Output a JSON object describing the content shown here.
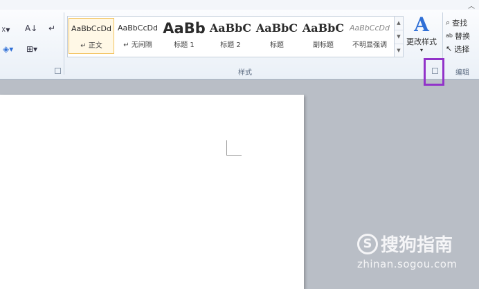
{
  "ribbon": {
    "collapse_icon": "chevron-up-icon",
    "styles_group_label": "样式",
    "editing_group_label": "编辑"
  },
  "styles": [
    {
      "sample": "AaBbCcDd",
      "name": "↵ 正文",
      "selected": true
    },
    {
      "sample": "AaBbCcDd",
      "name": "↵ 无间隔",
      "selected": false
    },
    {
      "sample": "AaBb",
      "name": "标题 1",
      "selected": false
    },
    {
      "sample": "AaBbC",
      "name": "标题 2",
      "selected": false
    },
    {
      "sample": "AaBbC",
      "name": "标题",
      "selected": false
    },
    {
      "sample": "AaBbC",
      "name": "副标题",
      "selected": false
    },
    {
      "sample": "AaBbCcDd",
      "name": "不明显强调",
      "selected": false
    }
  ],
  "change_styles": {
    "label": "更改样式"
  },
  "editing": {
    "find": "查找",
    "replace": "替换",
    "select": "选择"
  },
  "watermark": {
    "brand": "搜狗指南",
    "url": "zhinan.sogou.com"
  }
}
